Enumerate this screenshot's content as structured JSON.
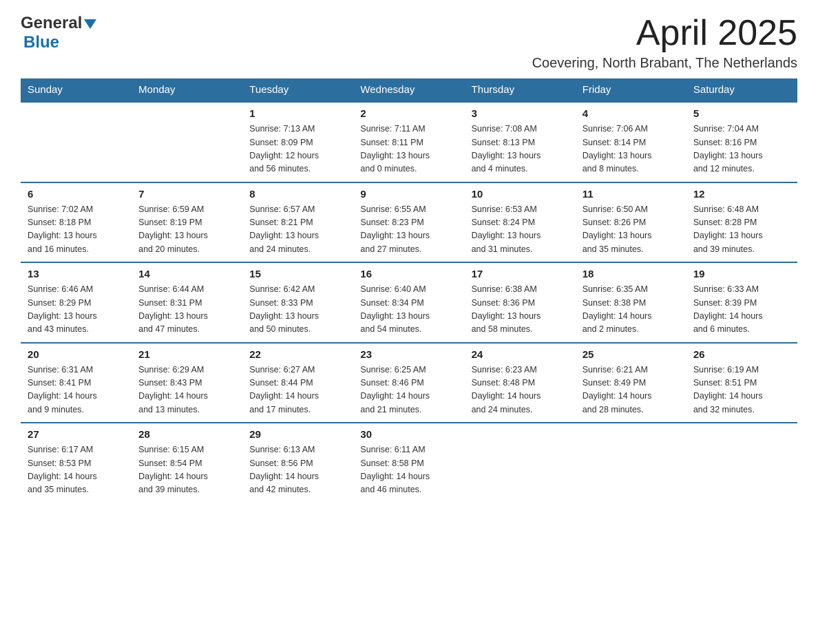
{
  "header": {
    "logo_general": "General",
    "logo_blue": "Blue",
    "month": "April 2025",
    "location": "Coevering, North Brabant, The Netherlands"
  },
  "days_of_week": [
    "Sunday",
    "Monday",
    "Tuesday",
    "Wednesday",
    "Thursday",
    "Friday",
    "Saturday"
  ],
  "weeks": [
    [
      {
        "day": "",
        "info": ""
      },
      {
        "day": "",
        "info": ""
      },
      {
        "day": "1",
        "info": "Sunrise: 7:13 AM\nSunset: 8:09 PM\nDaylight: 12 hours\nand 56 minutes."
      },
      {
        "day": "2",
        "info": "Sunrise: 7:11 AM\nSunset: 8:11 PM\nDaylight: 13 hours\nand 0 minutes."
      },
      {
        "day": "3",
        "info": "Sunrise: 7:08 AM\nSunset: 8:13 PM\nDaylight: 13 hours\nand 4 minutes."
      },
      {
        "day": "4",
        "info": "Sunrise: 7:06 AM\nSunset: 8:14 PM\nDaylight: 13 hours\nand 8 minutes."
      },
      {
        "day": "5",
        "info": "Sunrise: 7:04 AM\nSunset: 8:16 PM\nDaylight: 13 hours\nand 12 minutes."
      }
    ],
    [
      {
        "day": "6",
        "info": "Sunrise: 7:02 AM\nSunset: 8:18 PM\nDaylight: 13 hours\nand 16 minutes."
      },
      {
        "day": "7",
        "info": "Sunrise: 6:59 AM\nSunset: 8:19 PM\nDaylight: 13 hours\nand 20 minutes."
      },
      {
        "day": "8",
        "info": "Sunrise: 6:57 AM\nSunset: 8:21 PM\nDaylight: 13 hours\nand 24 minutes."
      },
      {
        "day": "9",
        "info": "Sunrise: 6:55 AM\nSunset: 8:23 PM\nDaylight: 13 hours\nand 27 minutes."
      },
      {
        "day": "10",
        "info": "Sunrise: 6:53 AM\nSunset: 8:24 PM\nDaylight: 13 hours\nand 31 minutes."
      },
      {
        "day": "11",
        "info": "Sunrise: 6:50 AM\nSunset: 8:26 PM\nDaylight: 13 hours\nand 35 minutes."
      },
      {
        "day": "12",
        "info": "Sunrise: 6:48 AM\nSunset: 8:28 PM\nDaylight: 13 hours\nand 39 minutes."
      }
    ],
    [
      {
        "day": "13",
        "info": "Sunrise: 6:46 AM\nSunset: 8:29 PM\nDaylight: 13 hours\nand 43 minutes."
      },
      {
        "day": "14",
        "info": "Sunrise: 6:44 AM\nSunset: 8:31 PM\nDaylight: 13 hours\nand 47 minutes."
      },
      {
        "day": "15",
        "info": "Sunrise: 6:42 AM\nSunset: 8:33 PM\nDaylight: 13 hours\nand 50 minutes."
      },
      {
        "day": "16",
        "info": "Sunrise: 6:40 AM\nSunset: 8:34 PM\nDaylight: 13 hours\nand 54 minutes."
      },
      {
        "day": "17",
        "info": "Sunrise: 6:38 AM\nSunset: 8:36 PM\nDaylight: 13 hours\nand 58 minutes."
      },
      {
        "day": "18",
        "info": "Sunrise: 6:35 AM\nSunset: 8:38 PM\nDaylight: 14 hours\nand 2 minutes."
      },
      {
        "day": "19",
        "info": "Sunrise: 6:33 AM\nSunset: 8:39 PM\nDaylight: 14 hours\nand 6 minutes."
      }
    ],
    [
      {
        "day": "20",
        "info": "Sunrise: 6:31 AM\nSunset: 8:41 PM\nDaylight: 14 hours\nand 9 minutes."
      },
      {
        "day": "21",
        "info": "Sunrise: 6:29 AM\nSunset: 8:43 PM\nDaylight: 14 hours\nand 13 minutes."
      },
      {
        "day": "22",
        "info": "Sunrise: 6:27 AM\nSunset: 8:44 PM\nDaylight: 14 hours\nand 17 minutes."
      },
      {
        "day": "23",
        "info": "Sunrise: 6:25 AM\nSunset: 8:46 PM\nDaylight: 14 hours\nand 21 minutes."
      },
      {
        "day": "24",
        "info": "Sunrise: 6:23 AM\nSunset: 8:48 PM\nDaylight: 14 hours\nand 24 minutes."
      },
      {
        "day": "25",
        "info": "Sunrise: 6:21 AM\nSunset: 8:49 PM\nDaylight: 14 hours\nand 28 minutes."
      },
      {
        "day": "26",
        "info": "Sunrise: 6:19 AM\nSunset: 8:51 PM\nDaylight: 14 hours\nand 32 minutes."
      }
    ],
    [
      {
        "day": "27",
        "info": "Sunrise: 6:17 AM\nSunset: 8:53 PM\nDaylight: 14 hours\nand 35 minutes."
      },
      {
        "day": "28",
        "info": "Sunrise: 6:15 AM\nSunset: 8:54 PM\nDaylight: 14 hours\nand 39 minutes."
      },
      {
        "day": "29",
        "info": "Sunrise: 6:13 AM\nSunset: 8:56 PM\nDaylight: 14 hours\nand 42 minutes."
      },
      {
        "day": "30",
        "info": "Sunrise: 6:11 AM\nSunset: 8:58 PM\nDaylight: 14 hours\nand 46 minutes."
      },
      {
        "day": "",
        "info": ""
      },
      {
        "day": "",
        "info": ""
      },
      {
        "day": "",
        "info": ""
      }
    ]
  ]
}
